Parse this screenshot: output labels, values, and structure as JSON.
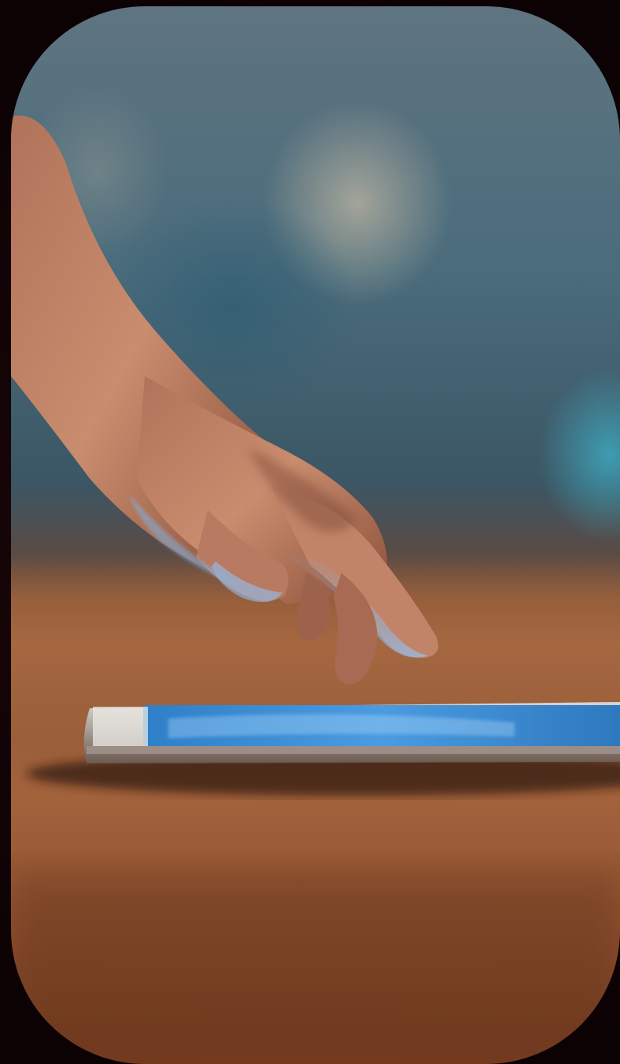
{
  "scene": {
    "subject": "hand-reaching-toward-smartphone",
    "palette": {
      "background_outer": "#120406",
      "backdrop_teal": "#3f6f80",
      "backdrop_gray": "#6c7c86",
      "table_brown": "#9a5a36",
      "table_dark": "#5a2e18",
      "screen_blue": "#3f8fd6",
      "skin": "#c9896b",
      "skin_shadow": "#7a4634",
      "skin_glow": "#8fc6ff"
    }
  }
}
